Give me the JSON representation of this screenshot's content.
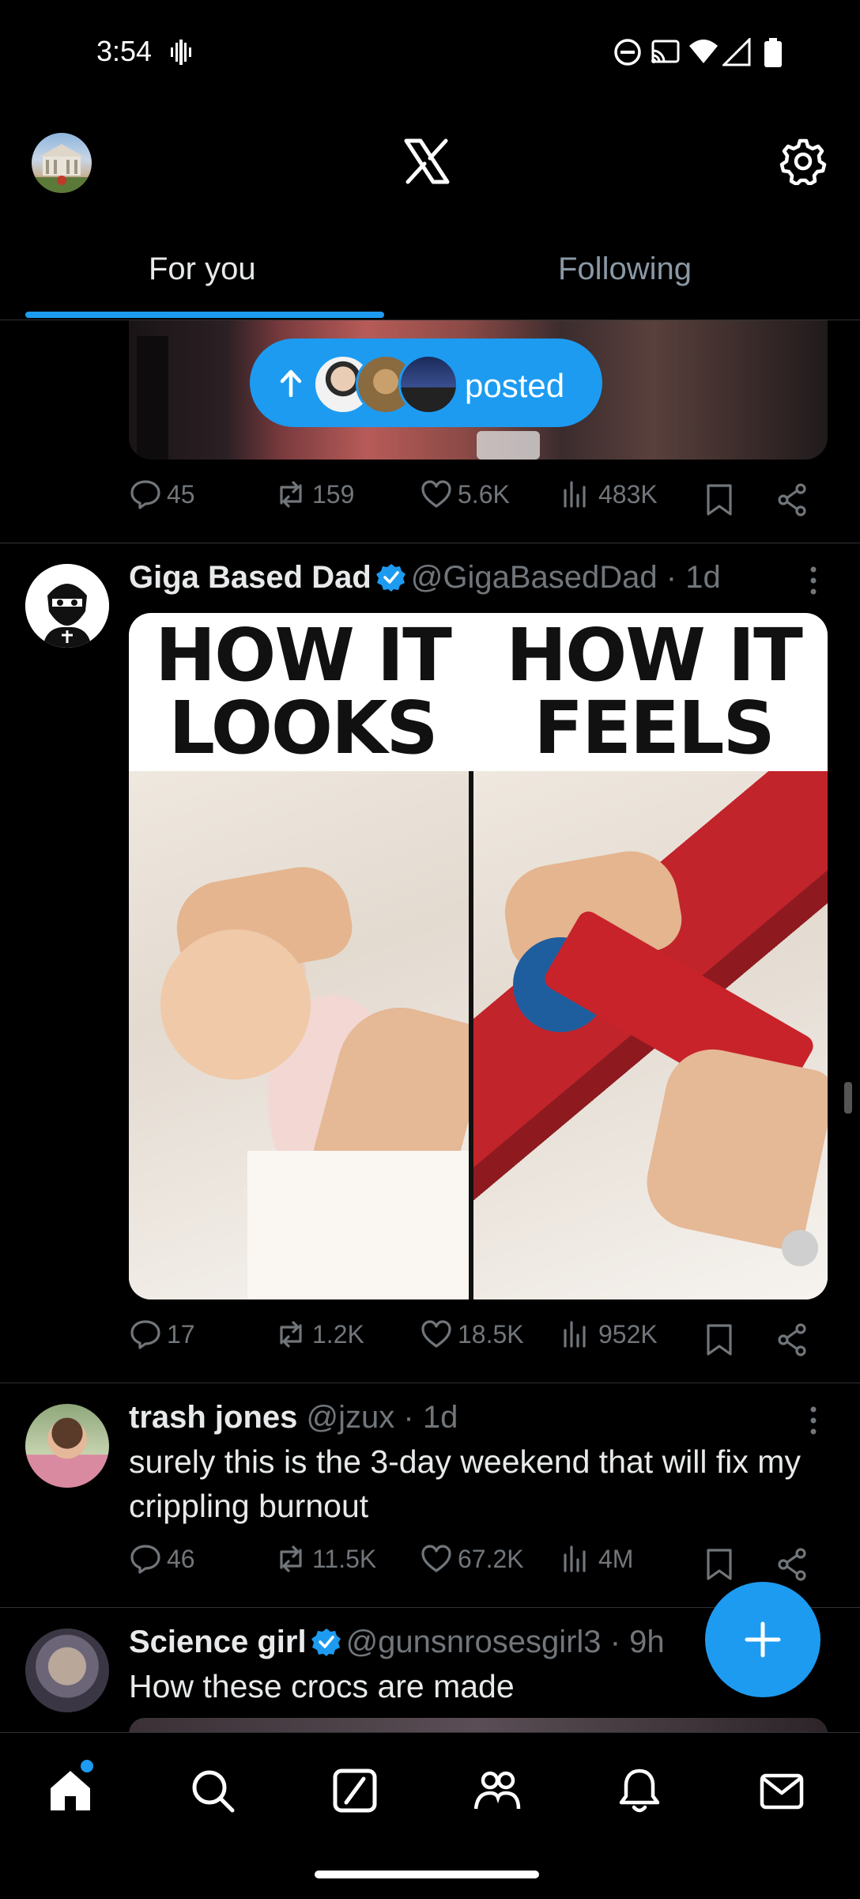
{
  "status_bar": {
    "time": "3:54"
  },
  "tabs": [
    {
      "label": "For you",
      "active": true
    },
    {
      "label": "Following",
      "active": false
    }
  ],
  "accent_color": "#1d9bf0",
  "new_posts_pill": {
    "label": "posted"
  },
  "posts": [
    {
      "stats": {
        "replies": "45",
        "reposts": "159",
        "likes": "5.6K",
        "views": "483K"
      }
    },
    {
      "display_name": "Giga Based Dad",
      "verified": true,
      "handle": "@GigaBasedDad",
      "time": "· 1d",
      "media": {
        "left_title": "HOW IT LOOKS",
        "right_title": "HOW IT FEELS"
      },
      "stats": {
        "replies": "17",
        "reposts": "1.2K",
        "likes": "18.5K",
        "views": "952K"
      }
    },
    {
      "display_name": "trash jones",
      "verified": false,
      "handle": "@jzux",
      "time": "· 1d",
      "text": "surely this is the 3-day weekend that will fix my crippling burnout",
      "stats": {
        "replies": "46",
        "reposts": "11.5K",
        "likes": "67.2K",
        "views": "4M"
      }
    },
    {
      "display_name": "Science girl",
      "verified": true,
      "handle": "@gunsnrosesgirl3",
      "time": "· 9h",
      "text": "How these crocs are made"
    }
  ],
  "bottom_nav": [
    "home-icon",
    "search-icon",
    "grok-icon",
    "communities-icon",
    "notifications-icon",
    "messages-icon"
  ]
}
